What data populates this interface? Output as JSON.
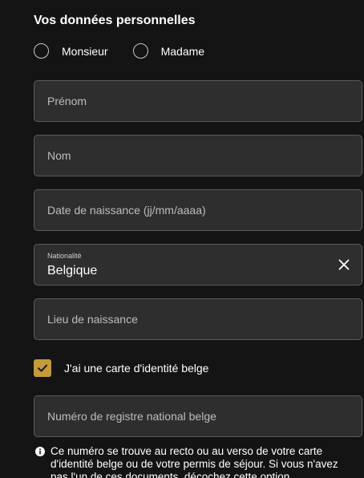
{
  "form": {
    "title": "Vos données personnelles",
    "civility": {
      "options": [
        "Monsieur",
        "Madame"
      ]
    },
    "fields": {
      "first_name": {
        "placeholder": "Prénom"
      },
      "last_name": {
        "placeholder": "Nom"
      },
      "birth_date": {
        "placeholder": "Date de naissance (jj/mm/aaaa)"
      },
      "nationality": {
        "label": "Nationalité",
        "value": "Belgique"
      },
      "birth_place": {
        "placeholder": "Lieu de naissance"
      },
      "national_register": {
        "placeholder": "Numéro de registre national belge"
      }
    },
    "belgian_id_checkbox": {
      "label": "J'ai une carte d'identité belge",
      "checked": true
    },
    "info": {
      "text": "Ce numéro se trouve au recto ou au verso de votre carte d'identité belge ou de votre permis de séjour. Si vous n'avez pas l'un de ces documents, décochez cette option."
    }
  },
  "colors": {
    "background": "#141414",
    "field_background": "#2e2e2e",
    "field_border": "#5b5b5b",
    "checkbox_accent": "#c39a3c"
  },
  "icons": {
    "clear": "close-icon",
    "check": "check-icon",
    "info": "info-icon"
  }
}
